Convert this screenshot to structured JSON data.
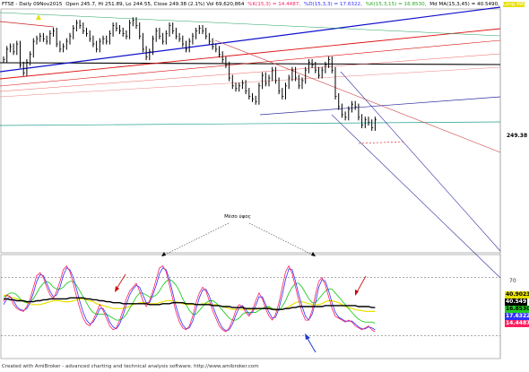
{
  "header": {
    "symbol": "FTSE - Daily 09Nov2015",
    "ohlc": "Open 245.7, Hi 251.89, Lo 244.55, Close 249.38 (2.1%) Vol 69,620,864",
    "ind1": "%K(15,3) = 14.4487,",
    "ind2": "%D(15,3,3) = 17.6322,",
    "ind3": "%K(15,3,15) = 16.8530,",
    "ind4": "Md MA(15,3,45) = 40.5490,",
    "ind5": "Long MA"
  },
  "colors": {
    "background": "#ffffff",
    "bars": "#000000",
    "blue_trend": "#1010cc",
    "red_trend": "#dd1010",
    "channel": "#3030a0",
    "k_line": "#ff2060",
    "d_line": "#3030ff",
    "green_line": "#22cc22",
    "yellow_line": "#e8e000",
    "black_line": "#000000",
    "arrow_red": "#cc0000",
    "arrow_blue": "#1a3ad0"
  },
  "annotation": {
    "label": "Μέσο ύψος"
  },
  "footer": "Created with AmiBroker - advanced charting and technical analysis software. http://www.amibroker.com",
  "chart_data": [
    {
      "type": "line",
      "name": "price",
      "y_last": "249.38",
      "values": [
        272,
        276,
        277,
        275,
        278,
        270,
        267,
        271,
        274,
        279,
        280,
        281,
        280,
        279,
        282,
        283,
        278,
        276,
        277,
        279,
        281,
        284,
        286,
        285,
        283,
        282,
        280,
        278,
        276,
        279,
        280,
        279,
        282,
        285,
        284,
        283,
        282,
        281,
        286,
        287,
        285,
        281,
        276,
        273,
        275,
        280,
        283,
        281,
        279,
        282,
        285,
        283,
        281,
        280,
        278,
        276,
        279,
        281,
        283,
        284,
        283,
        281,
        279,
        277,
        276,
        274,
        272,
        270,
        265,
        262,
        261,
        262,
        263,
        260,
        258,
        257,
        256,
        262,
        266,
        263,
        265,
        268,
        264,
        260,
        258,
        262,
        265,
        268,
        265,
        262,
        264,
        268,
        271,
        270,
        268,
        266,
        268,
        270,
        272,
        268,
        258,
        254,
        251,
        250,
        253,
        255,
        254,
        250,
        247,
        249,
        248,
        246,
        249
      ]
    },
    {
      "type": "line",
      "name": "oscillator",
      "y_tick": "70",
      "ylim": [
        0,
        100
      ],
      "series": [
        {
          "name": "%K(15,3)",
          "values": [
            55,
            62,
            60,
            52,
            48,
            46,
            45,
            50,
            58,
            70,
            82,
            85,
            80,
            70,
            62,
            58,
            66,
            76,
            88,
            92,
            86,
            74,
            60,
            48,
            38,
            32,
            30,
            36,
            44,
            52,
            46,
            38,
            30,
            26,
            28,
            36,
            46,
            58,
            66,
            70,
            74,
            66,
            56,
            50,
            56,
            66,
            78,
            90,
            92,
            86,
            72,
            58,
            44,
            34,
            28,
            26,
            30,
            40,
            54,
            64,
            70,
            66,
            56,
            46,
            38,
            30,
            26,
            24,
            28,
            36,
            46,
            52,
            50,
            44,
            40,
            46,
            56,
            64,
            58,
            48,
            40,
            36,
            42,
            54,
            70,
            86,
            92,
            84,
            70,
            56,
            44,
            36,
            36,
            46,
            62,
            76,
            80,
            72,
            60,
            48,
            40,
            38,
            36,
            34,
            36,
            34,
            30,
            28,
            26,
            28,
            30,
            26,
            24
          ]
        },
        {
          "name": "%D(15,3,3)",
          "values": [
            52,
            58,
            60,
            56,
            50,
            47,
            46,
            48,
            54,
            64,
            76,
            83,
            82,
            74,
            66,
            60,
            62,
            70,
            82,
            90,
            88,
            80,
            68,
            55,
            44,
            36,
            32,
            34,
            40,
            48,
            48,
            42,
            34,
            29,
            27,
            32,
            41,
            52,
            62,
            68,
            72,
            70,
            62,
            54,
            54,
            62,
            72,
            84,
            90,
            88,
            78,
            64,
            50,
            39,
            31,
            27,
            28,
            35,
            47,
            59,
            67,
            68,
            61,
            51,
            42,
            34,
            28,
            25,
            26,
            32,
            41,
            49,
            51,
            47,
            42,
            44,
            51,
            60,
            60,
            52,
            44,
            38,
            39,
            48,
            62,
            78,
            89,
            88,
            76,
            62,
            50,
            40,
            36,
            42,
            54,
            70,
            78,
            76,
            66,
            54,
            44,
            39,
            37,
            35,
            35,
            35,
            32,
            29,
            27,
            27,
            29,
            28,
            26
          ]
        },
        {
          "name": "%K(15,3,15)",
          "values": [
            60,
            62,
            64,
            64,
            62,
            58,
            55,
            54,
            55,
            58,
            64,
            70,
            74,
            76,
            74,
            70,
            68,
            68,
            70,
            74,
            76,
            76,
            72,
            66,
            60,
            54,
            48,
            44,
            42,
            42,
            42,
            42,
            40,
            38,
            36,
            36,
            38,
            42,
            48,
            54,
            60,
            64,
            64,
            62,
            60,
            60,
            62,
            66,
            72,
            76,
            78,
            76,
            72,
            66,
            58,
            52,
            46,
            42,
            42,
            46,
            50,
            54,
            56,
            56,
            54,
            50,
            46,
            42,
            38,
            36,
            36,
            38,
            42,
            44,
            44,
            44,
            44,
            46,
            48,
            50,
            50,
            48,
            46,
            46,
            50,
            56,
            64,
            70,
            74,
            74,
            70,
            64,
            58,
            54,
            54,
            58,
            62,
            66,
            68,
            68,
            64,
            60,
            56,
            52,
            48,
            44,
            40,
            37,
            35,
            34,
            34,
            34,
            33
          ]
        },
        {
          "name": "Md MA(15,3,45)",
          "values": [
            58,
            58,
            57,
            57,
            56,
            56,
            56,
            55,
            55,
            55,
            56,
            56,
            57,
            57,
            58,
            58,
            58,
            58,
            58,
            58,
            59,
            59,
            59,
            59,
            59,
            58,
            58,
            57,
            57,
            56,
            56,
            55,
            55,
            54,
            54,
            54,
            53,
            53,
            53,
            53,
            53,
            53,
            53,
            53,
            52,
            52,
            52,
            52,
            53,
            53,
            53,
            54,
            54,
            54,
            54,
            53,
            53,
            53,
            52,
            52,
            52,
            52,
            52,
            51,
            51,
            51,
            50,
            50,
            50,
            49,
            49,
            49,
            49,
            48,
            48,
            48,
            48,
            48,
            48,
            48,
            48,
            47,
            47,
            47,
            47,
            48,
            48,
            49,
            49,
            50,
            50,
            50,
            50,
            50,
            50,
            50,
            50,
            51,
            51,
            51,
            51,
            51,
            51,
            51,
            51,
            51,
            51,
            50,
            50,
            50,
            50,
            49,
            49
          ]
        },
        {
          "name": "Long MA",
          "values": [
            62,
            61,
            60,
            59,
            58,
            57,
            55,
            54,
            53,
            52,
            52,
            52,
            53,
            54,
            55,
            56,
            56,
            56,
            55,
            55,
            55,
            56,
            57,
            58,
            58,
            57,
            56,
            55,
            53,
            52,
            51,
            50,
            49,
            48,
            48,
            48,
            48,
            49,
            50,
            52,
            53,
            54,
            54,
            54,
            53,
            53,
            53,
            54,
            55,
            56,
            56,
            56,
            55,
            54,
            53,
            52,
            52,
            52,
            52,
            52,
            53,
            53,
            53,
            52,
            52,
            51,
            50,
            49,
            48,
            47,
            47,
            47,
            47,
            47,
            47,
            47,
            47,
            48,
            48,
            49,
            49,
            48,
            47,
            47,
            47,
            48,
            50,
            52,
            54,
            55,
            55,
            54,
            53,
            52,
            52,
            52,
            53,
            55,
            56,
            56,
            55,
            54,
            52,
            50,
            49,
            48,
            47,
            46,
            46,
            45,
            45,
            45,
            45
          ]
        }
      ],
      "value_labels": [
        "40.9023",
        "40.549",
        "16.8530",
        "17.6322",
        "14.4487"
      ]
    }
  ]
}
